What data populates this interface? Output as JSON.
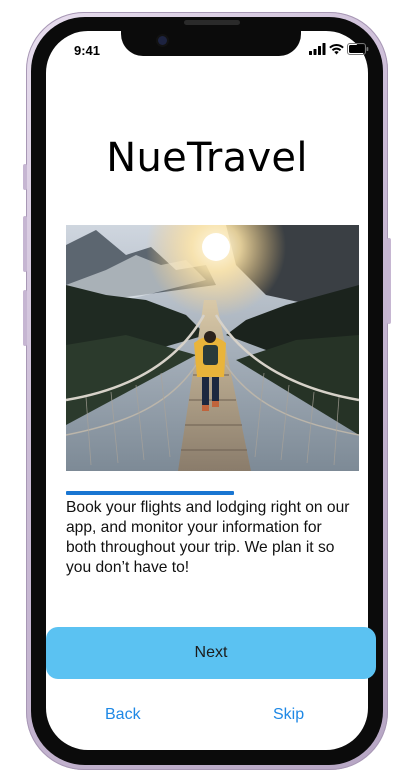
{
  "status_bar": {
    "time": "9:41",
    "icons": [
      "signal-icon",
      "wifi-icon",
      "battery-icon"
    ]
  },
  "app": {
    "title": "NueTravel"
  },
  "onboarding": {
    "hero_image": "person-walking-on-suspension-bridge-at-sunrise",
    "progress": 0.5,
    "description": "Book your flights and lodging right on our app, and monitor your information for both throughout your trip. We plan it so you don’t have to!"
  },
  "actions": {
    "next_label": "Next",
    "back_label": "Back",
    "skip_label": "Skip"
  },
  "colors": {
    "primary_button": "#5bc2f2",
    "link": "#1e88e5",
    "progress": "#1976d2"
  }
}
